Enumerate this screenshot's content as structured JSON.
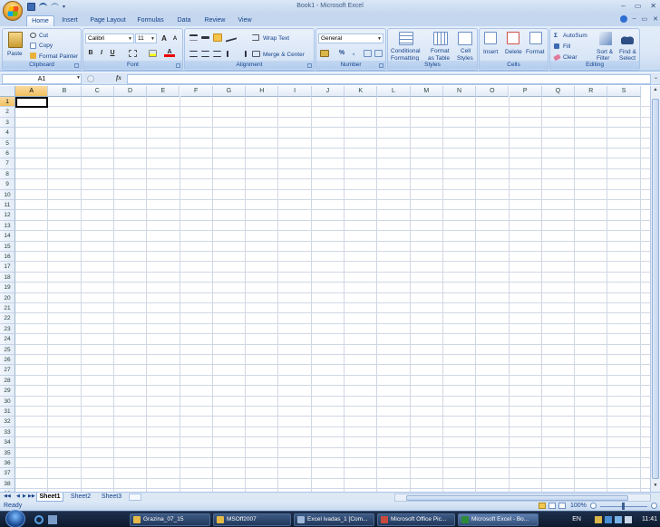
{
  "window": {
    "title": "Book1 - Microsoft Excel",
    "minimize": "–",
    "restore": "▭",
    "close": "✕"
  },
  "tabs": [
    "Home",
    "Insert",
    "Page Layout",
    "Formulas",
    "Data",
    "Review",
    "View"
  ],
  "active_tab": "Home",
  "ribbon": {
    "clipboard": {
      "label": "Clipboard",
      "paste": "Paste",
      "cut": "Cut",
      "copy": "Copy",
      "format_painter": "Format Painter"
    },
    "font": {
      "label": "Font",
      "font_name": "Calibri",
      "font_size": "11",
      "bold": "B",
      "italic": "I",
      "underline": "U",
      "grow": "A",
      "shrink": "A",
      "font_color": "A"
    },
    "alignment": {
      "label": "Alignment",
      "wrap_text": "Wrap Text",
      "merge_center": "Merge & Center"
    },
    "number": {
      "label": "Number",
      "format": "General",
      "percent": "%",
      "comma": ","
    },
    "styles": {
      "label": "Styles",
      "conditional": "Conditional",
      "conditional2": "Formatting",
      "format_table": "Format",
      "format_table2": "as Table",
      "cell_styles": "Cell",
      "cell_styles2": "Styles"
    },
    "cells": {
      "label": "Cells",
      "insert": "Insert",
      "delete": "Delete",
      "format": "Format"
    },
    "editing": {
      "label": "Editing",
      "autosum": "AutoSum",
      "fill": "Fill",
      "clear": "Clear",
      "sort_filter": "Sort &",
      "sort_filter2": "Filter",
      "find_select": "Find &",
      "find_select2": "Select"
    }
  },
  "formula_bar": {
    "name_box": "A1",
    "fx": "fx",
    "value": ""
  },
  "grid": {
    "columns": [
      "A",
      "B",
      "C",
      "D",
      "E",
      "F",
      "G",
      "H",
      "I",
      "J",
      "K",
      "L",
      "M",
      "N",
      "O",
      "P",
      "Q",
      "R",
      "S"
    ],
    "rows": [
      "1",
      "2",
      "3",
      "4",
      "5",
      "6",
      "7",
      "8",
      "9",
      "10",
      "11",
      "12",
      "13",
      "14",
      "15",
      "16",
      "17",
      "18",
      "19",
      "20",
      "21",
      "22",
      "23",
      "24",
      "25",
      "26",
      "27",
      "28",
      "29",
      "30",
      "31",
      "32",
      "33",
      "34",
      "35",
      "36",
      "37",
      "38",
      "39"
    ],
    "active_cell": "A1"
  },
  "sheets": [
    "Sheet1",
    "Sheet2",
    "Sheet3"
  ],
  "active_sheet": "Sheet1",
  "status": {
    "text": "Ready",
    "zoom": "100%"
  },
  "taskbar": {
    "items": [
      "Grazina_07_15",
      "MSOff2007",
      "Excel ivadas_1 [Com...",
      "Microsoft Office Pic...",
      "Microsoft Excel - Bo..."
    ],
    "lang": "EN",
    "clock": "11:41"
  }
}
